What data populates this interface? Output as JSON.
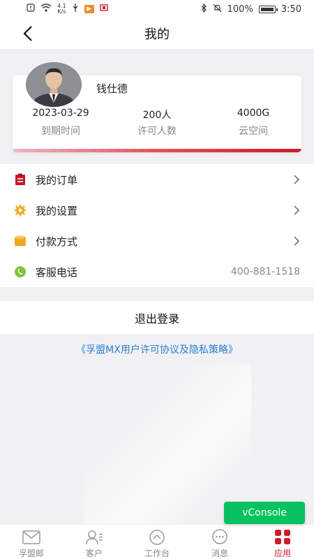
{
  "status_bar": {
    "speed_value": "4.1",
    "speed_unit": "K/s",
    "battery": "100%",
    "time": "3:50"
  },
  "navbar": {
    "title": "我的"
  },
  "profile": {
    "name": "钱仕德",
    "stats": [
      {
        "value": "2023-03-29",
        "label": "到期时间"
      },
      {
        "value": "200人",
        "label": "许可人数"
      },
      {
        "value": "4000G",
        "label": "云空间"
      }
    ]
  },
  "menu": {
    "items": [
      {
        "label": "我的订单",
        "icon": "order-icon",
        "value": ""
      },
      {
        "label": "我的设置",
        "icon": "gear-icon",
        "value": ""
      },
      {
        "label": "付款方式",
        "icon": "wallet-icon",
        "value": ""
      },
      {
        "label": "客服电话",
        "icon": "phone-icon",
        "value": "400-881-1518"
      }
    ]
  },
  "logout_label": "退出登录",
  "agreement_text": "《孚盟MX用户许可协议及隐私策略》",
  "vconsole_label": "vConsole",
  "tabbar": {
    "tabs": [
      {
        "label": "孚盟邮",
        "icon": "mail-icon"
      },
      {
        "label": "客户",
        "icon": "contacts-icon"
      },
      {
        "label": "工作台",
        "icon": "dashboard-icon"
      },
      {
        "label": "消息",
        "icon": "message-icon"
      },
      {
        "label": "应用",
        "icon": "apps-icon"
      }
    ],
    "active": "应用"
  },
  "colors": {
    "accent_red": "#d0192b",
    "link_blue": "#2b7fd3",
    "vconsole_green": "#08c160"
  }
}
